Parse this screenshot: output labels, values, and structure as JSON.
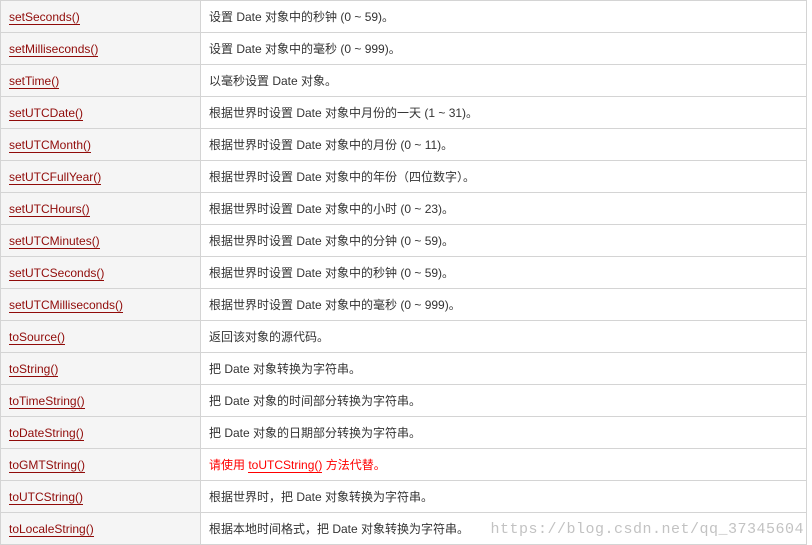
{
  "rows": [
    {
      "method": "setSeconds()",
      "desc": "设置 Date 对象中的秒钟 (0 ~ 59)。",
      "deprecated": false
    },
    {
      "method": "setMilliseconds()",
      "desc": "设置 Date 对象中的毫秒 (0 ~ 999)。",
      "deprecated": false
    },
    {
      "method": "setTime()",
      "desc": "以毫秒设置 Date 对象。",
      "deprecated": false
    },
    {
      "method": "setUTCDate()",
      "desc": "根据世界时设置 Date 对象中月份的一天 (1 ~ 31)。",
      "deprecated": false
    },
    {
      "method": "setUTCMonth()",
      "desc": "根据世界时设置 Date 对象中的月份 (0 ~ 11)。",
      "deprecated": false
    },
    {
      "method": "setUTCFullYear()",
      "desc": "根据世界时设置 Date 对象中的年份（四位数字）。",
      "deprecated": false
    },
    {
      "method": "setUTCHours()",
      "desc": "根据世界时设置 Date 对象中的小时 (0 ~ 23)。",
      "deprecated": false
    },
    {
      "method": "setUTCMinutes()",
      "desc": "根据世界时设置 Date 对象中的分钟 (0 ~ 59)。",
      "deprecated": false
    },
    {
      "method": "setUTCSeconds()",
      "desc": "根据世界时设置 Date 对象中的秒钟 (0 ~ 59)。",
      "deprecated": false
    },
    {
      "method": "setUTCMilliseconds()",
      "desc": "根据世界时设置 Date 对象中的毫秒 (0 ~ 999)。",
      "deprecated": false
    },
    {
      "method": "toSource()",
      "desc": "返回该对象的源代码。",
      "deprecated": false
    },
    {
      "method": "toString()",
      "desc": "把 Date 对象转换为字符串。",
      "deprecated": false
    },
    {
      "method": "toTimeString()",
      "desc": "把 Date 对象的时间部分转换为字符串。",
      "deprecated": false
    },
    {
      "method": "toDateString()",
      "desc": "把 Date 对象的日期部分转换为字符串。",
      "deprecated": false
    },
    {
      "method": "toGMTString()",
      "desc": "请使用 toUTCString() 方法代替。",
      "deprecated": true,
      "dep_prefix": "请使用 ",
      "dep_link": "toUTCString()",
      "dep_suffix": " 方法代替。"
    },
    {
      "method": "toUTCString()",
      "desc": "根据世界时，把 Date 对象转换为字符串。",
      "deprecated": false
    },
    {
      "method": "toLocaleString()",
      "desc": "根据本地时间格式，把 Date 对象转换为字符串。",
      "deprecated": false
    }
  ],
  "watermark": "https://blog.csdn.net/qq_37345604"
}
